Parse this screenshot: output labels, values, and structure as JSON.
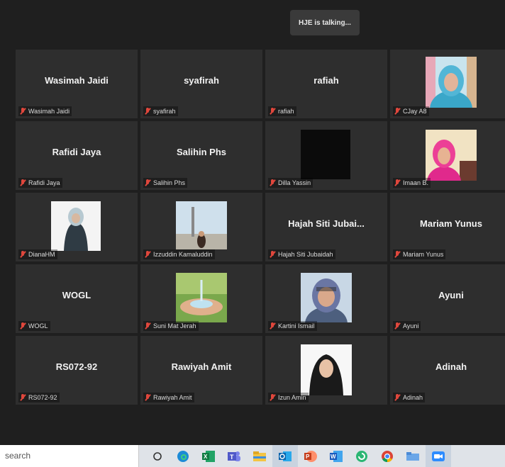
{
  "talking_indicator": "HJE is talking...",
  "participants": [
    {
      "display": "Wasimah Jaidi",
      "label": "Wasimah Jaidi",
      "type": "name"
    },
    {
      "display": "syafirah",
      "label": "syafirah",
      "type": "name"
    },
    {
      "display": "rafiah",
      "label": "rafiah",
      "type": "name"
    },
    {
      "display": "",
      "label": "CJay A8",
      "type": "photo",
      "photo": "woman-blue-hijab"
    },
    {
      "display": "Rafidi Jaya",
      "label": "Rafidi Jaya",
      "type": "name"
    },
    {
      "display": "Salihin Phs",
      "label": "Salihin Phs",
      "type": "name"
    },
    {
      "display": "",
      "label": "Dilla Yassin",
      "type": "photo",
      "photo": "black-video"
    },
    {
      "display": "",
      "label": "Imaan B.",
      "type": "photo",
      "photo": "woman-pink-hijab"
    },
    {
      "display": "",
      "label": "DianaHM",
      "type": "photo",
      "photo": "woman-grey-hijab"
    },
    {
      "display": "",
      "label": "Izzuddin Kamaluddin",
      "type": "photo",
      "photo": "man-monument"
    },
    {
      "display": "Hajah  Siti  Jubai...",
      "label": "Hajah Siti Jubaidah",
      "type": "name"
    },
    {
      "display": "Mariam Yunus",
      "label": "Mariam Yunus",
      "type": "name"
    },
    {
      "display": "WOGL",
      "label": "WOGL",
      "type": "name"
    },
    {
      "display": "",
      "label": "Suni Mat Jerah",
      "type": "photo",
      "photo": "hands-water"
    },
    {
      "display": "",
      "label": "Kartini Ismail",
      "type": "photo",
      "photo": "woman-scarf-smile"
    },
    {
      "display": "Ayuni",
      "label": "Ayuni",
      "type": "name"
    },
    {
      "display": "RS072-92",
      "label": "RS072-92",
      "type": "name"
    },
    {
      "display": "Rawiyah Amit",
      "label": "Rawiyah Amit",
      "type": "name"
    },
    {
      "display": "",
      "label": "Izun Amin",
      "type": "photo",
      "photo": "woman-black-hijab"
    },
    {
      "display": "Adinah",
      "label": "Adinah",
      "type": "name"
    }
  ],
  "taskbar": {
    "search_text": "search",
    "icons": [
      "cortana-circle-icon",
      "edge-icon",
      "excel-icon",
      "teams-icon",
      "file-explorer-icon",
      "outlook-icon",
      "powerpoint-icon",
      "word-icon",
      "green-app-icon",
      "chrome-icon",
      "folder-app-icon",
      "zoom-icon"
    ]
  },
  "colors": {
    "tile": "#2e2e2e",
    "background": "#1f1f1f",
    "muted": "#e0473c",
    "taskbar": "#dfe3e8"
  }
}
